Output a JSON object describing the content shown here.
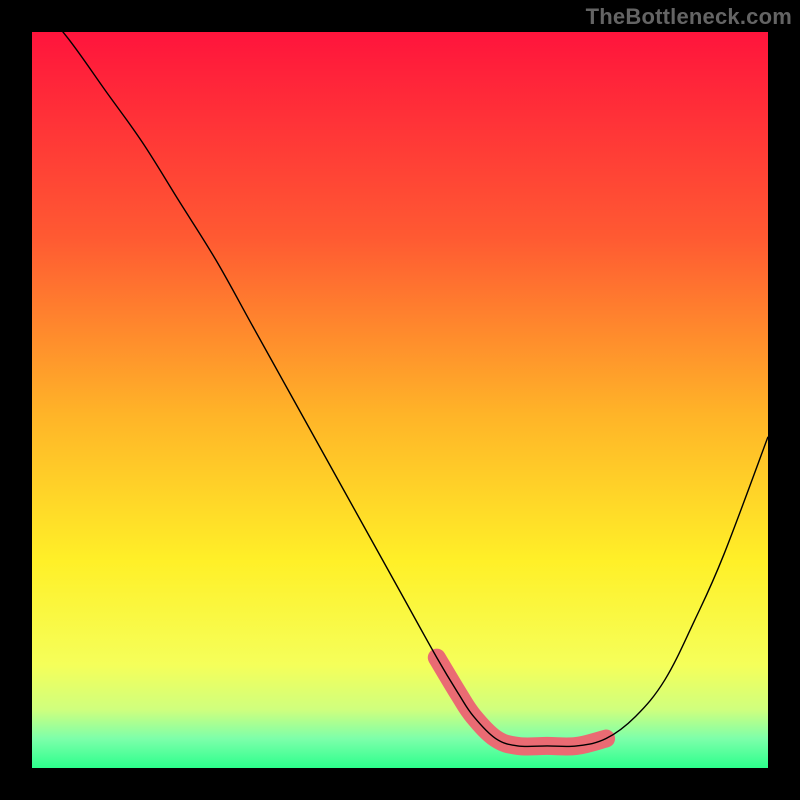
{
  "watermark": "TheBottleneck.com",
  "colors": {
    "top": "#ff143c",
    "mid1": "#ff5a32",
    "mid2": "#ffb428",
    "mid3": "#fff028",
    "mid4": "#f5ff5a",
    "mid5": "#d0ff7d",
    "mid6": "#7dffaa",
    "bottom": "#2cff8c",
    "pink": "#ea6b73",
    "frame": "#000000"
  },
  "gradient_stops": [
    {
      "offset": 0.0,
      "key": "top"
    },
    {
      "offset": 0.28,
      "key": "mid1"
    },
    {
      "offset": 0.52,
      "key": "mid2"
    },
    {
      "offset": 0.72,
      "key": "mid3"
    },
    {
      "offset": 0.86,
      "key": "mid4"
    },
    {
      "offset": 0.92,
      "key": "mid5"
    },
    {
      "offset": 0.96,
      "key": "mid6"
    },
    {
      "offset": 1.0,
      "key": "bottom"
    }
  ],
  "chart_data": {
    "type": "line",
    "title": "",
    "xlabel": "",
    "ylabel": "",
    "xlim": [
      0,
      100
    ],
    "ylim": [
      0,
      100
    ],
    "series": [
      {
        "name": "bottleneck-curve",
        "x": [
          0,
          5,
          10,
          15,
          20,
          25,
          30,
          35,
          40,
          45,
          50,
          55,
          58,
          60,
          63,
          66,
          70,
          74,
          78,
          82,
          86,
          90,
          94,
          100
        ],
        "y": [
          105,
          99,
          92,
          85,
          77,
          69,
          60,
          51,
          42,
          33,
          24,
          15,
          10,
          7,
          4,
          3,
          3,
          3,
          4,
          7,
          12,
          20,
          29,
          45
        ]
      }
    ],
    "highlight": {
      "name": "valley-highlight",
      "x": [
        55,
        58,
        60,
        63,
        66,
        70,
        74,
        78
      ],
      "y": [
        15,
        10,
        7,
        4,
        3,
        3,
        3,
        4
      ]
    }
  }
}
